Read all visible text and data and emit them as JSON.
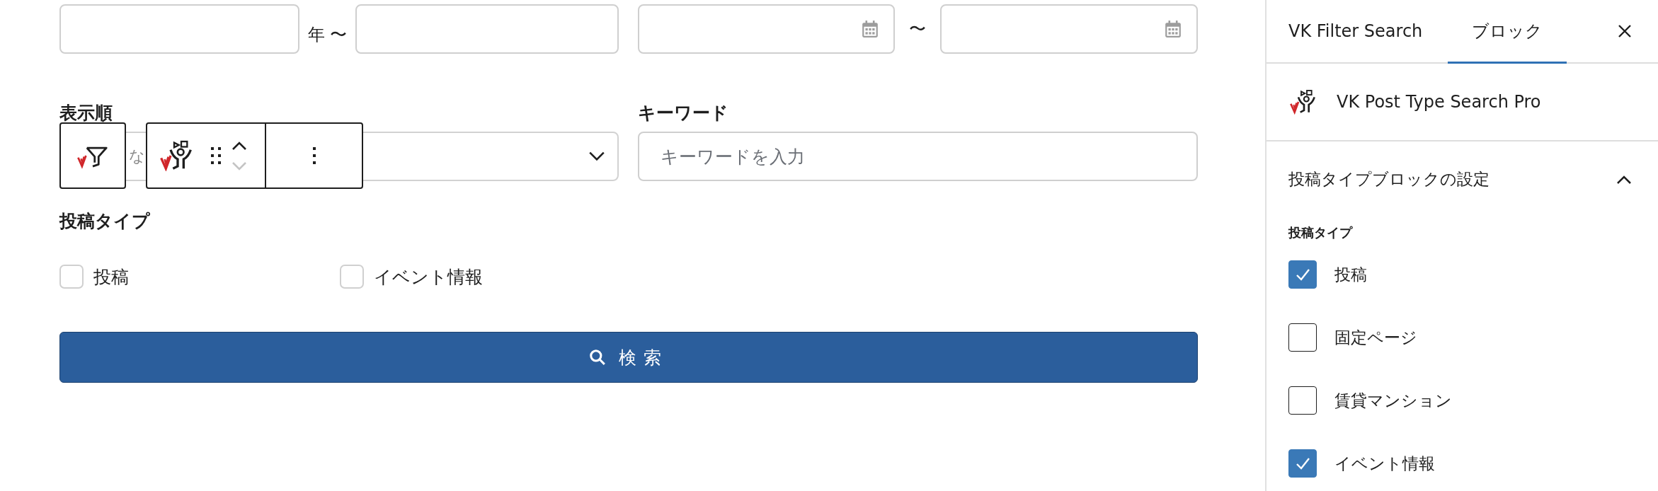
{
  "form": {
    "year_range": {
      "separator": "年 〜"
    },
    "date_range": {
      "separator": "〜"
    },
    "order": {
      "label": "表示順",
      "value": "な"
    },
    "keyword": {
      "label": "キーワード",
      "placeholder": "キーワードを入力"
    },
    "post_type": {
      "label": "投稿タイプ",
      "options": [
        {
          "label": "投稿",
          "checked": false
        },
        {
          "label": "イベント情報",
          "checked": false
        }
      ]
    },
    "search_button": {
      "label": "検索"
    }
  },
  "block_toolbar": {
    "move_up": {
      "disabled": false
    },
    "move_down": {
      "disabled": true
    }
  },
  "sidebar": {
    "tabs": [
      {
        "label": "VK Filter Search",
        "selected": false
      },
      {
        "label": "ブロック",
        "selected": true
      }
    ],
    "block": {
      "title": "VK Post Type Search Pro"
    },
    "panel": {
      "title": "投稿タイプブロックの設定",
      "expanded": true,
      "field_label": "投稿タイプ",
      "options": [
        {
          "label": "投稿",
          "checked": true
        },
        {
          "label": "固定ページ",
          "checked": false
        },
        {
          "label": "賃貸マンション",
          "checked": false
        },
        {
          "label": "イベント情報",
          "checked": true
        }
      ]
    }
  }
}
